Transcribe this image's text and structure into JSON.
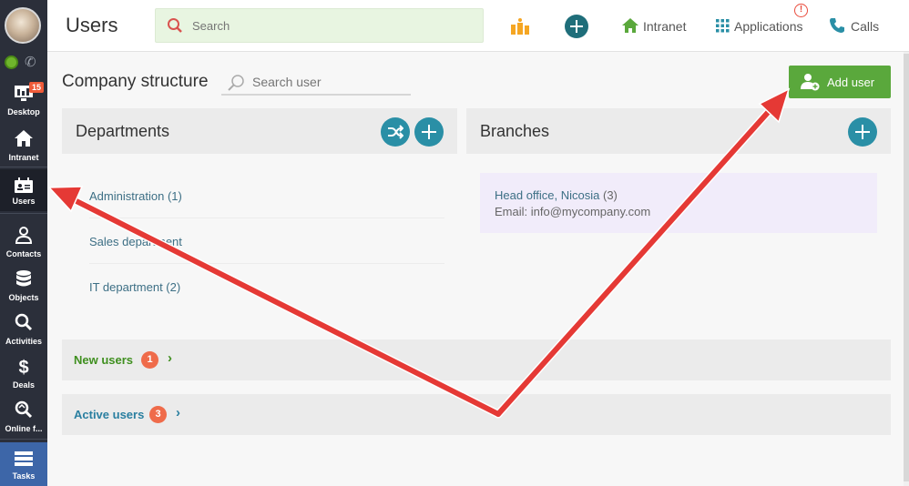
{
  "sidebar": {
    "desktop_badge": "15",
    "items": [
      {
        "label": "Desktop"
      },
      {
        "label": "Intranet"
      },
      {
        "label": "Users"
      },
      {
        "label": "Contacts"
      },
      {
        "label": "Objects"
      },
      {
        "label": "Activities"
      },
      {
        "label": "Deals"
      },
      {
        "label": "Online f..."
      },
      {
        "label": "Tasks"
      }
    ]
  },
  "header": {
    "title": "Users",
    "search_placeholder": "Search",
    "intranet": "Intranet",
    "applications": "Applications",
    "applications_alert": "!",
    "calls": "Calls"
  },
  "main": {
    "section_title": "Company structure",
    "user_search_placeholder": "Search user",
    "add_user": "Add user",
    "departments": {
      "title": "Departments",
      "items": [
        "Administration (1)",
        "Sales department",
        "IT department (2)"
      ]
    },
    "branches": {
      "title": "Branches",
      "card_title": "Head office, Nicosia",
      "card_count": "(3)",
      "card_email": "Email: info@mycompany.com"
    },
    "new_users": {
      "label": "New users",
      "count": "1"
    },
    "active_users": {
      "label": "Active users",
      "count": "3"
    }
  },
  "colors": {
    "sidebar": "#2b2f3a",
    "accent_green": "#5aa83c",
    "accent_teal": "#2a8fa6",
    "badge": "#ef6b4a",
    "arrow_red": "#e53935"
  }
}
